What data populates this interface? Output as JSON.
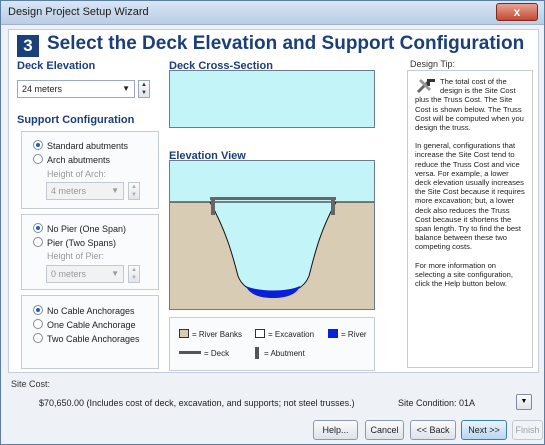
{
  "window": {
    "title": "Design Project Setup Wizard",
    "close_label": "x"
  },
  "header": {
    "step": "3",
    "title": "Select the Deck Elevation and Support Configuration"
  },
  "deck_elevation": {
    "section_title": "Deck Elevation",
    "value": "24 meters"
  },
  "support": {
    "section_title": "Support Configuration",
    "abutments": {
      "options": [
        "Standard abutments",
        "Arch abutments"
      ],
      "selected": 0,
      "height_label": "Height of Arch:",
      "height_value": "4 meters"
    },
    "pier": {
      "options": [
        "No Pier (One Span)",
        "Pier (Two Spans)"
      ],
      "selected": 0,
      "height_label": "Height of Pier:",
      "height_value": "0 meters"
    },
    "anchorages": {
      "options": [
        "No Cable Anchorages",
        "One Cable Anchorage",
        "Two Cable Anchorages"
      ],
      "selected": 0
    }
  },
  "cross_section": {
    "title": "Deck Cross-Section"
  },
  "elevation_view": {
    "title": "Elevation View"
  },
  "legend": {
    "river_banks": "= River Banks",
    "excavation": "= Excavation",
    "river": "= River",
    "deck": "= Deck",
    "abutment": "= Abutment"
  },
  "tip": {
    "title": "Design Tip:",
    "paragraphs": [
      "The total cost of the design is the Site Cost plus the Truss Cost. The Site Cost is shown below. The Truss Cost will be computed when you design the truss.",
      "In general, configurations that increase the Site Cost tend to reduce the Truss Cost and vice versa. For example, a lower deck elevation usually increases the Site Cost because it requires more excavation; but, a lower deck also reduces the Truss Cost because it shortens the span length. Try to find the best balance between these two competing costs.",
      "For more information on selecting a site configuration, click the Help button below."
    ]
  },
  "site_cost": {
    "label": "Site Cost:",
    "value": "$70,650.00 (Includes cost of deck, excavation, and supports; not steel trusses.)",
    "condition": "Site Condition: 01A"
  },
  "buttons": {
    "help": "Help...",
    "cancel": "Cancel",
    "back": "<< Back",
    "next": "Next >>",
    "finish": "Finish"
  },
  "colors": {
    "accent": "#1a3f7a",
    "river": "#0a1fd8",
    "sky": "#c3f4f8",
    "bank": "#d9ccb4"
  }
}
